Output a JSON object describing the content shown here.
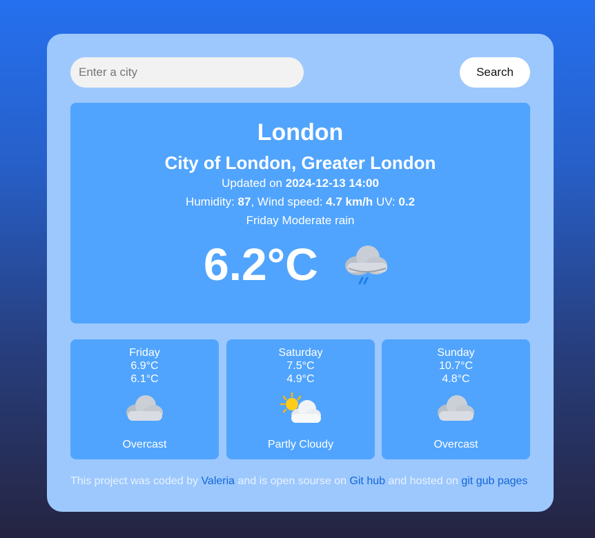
{
  "search": {
    "placeholder": "Enter a city",
    "button_label": "Search"
  },
  "current": {
    "city": "London",
    "region": "City of London, Greater London",
    "updated_label": "Updated on",
    "updated_value": "2024-12-13 14:00",
    "humidity_label": "Humidity:",
    "humidity_value": "87",
    "wind_label": "Wind speed:",
    "wind_value": "4.7 km/h",
    "uv_label": "UV:",
    "uv_value": "0.2",
    "description": "Friday Moderate rain",
    "temperature": "6.2°C",
    "icon": "rain-cloud-icon"
  },
  "forecast": [
    {
      "day": "Friday",
      "high": "6.9°C",
      "low": "6.1°C",
      "condition": "Overcast",
      "icon": "cloud-icon"
    },
    {
      "day": "Saturday",
      "high": "7.5°C",
      "low": "4.9°C",
      "condition": "Partly Cloudy",
      "icon": "sun-behind-cloud-icon"
    },
    {
      "day": "Sunday",
      "high": "10.7°C",
      "low": "4.8°C",
      "condition": "Overcast",
      "icon": "cloud-icon"
    }
  ],
  "footer": {
    "text_1": "This project was coded by",
    "author": "Valeria",
    "text_2": "and is open sourse on",
    "repo_link": "Git hub",
    "text_3": "and hosted on",
    "host_link": "git gub pages"
  },
  "colors": {
    "card": "#9dc8fd",
    "panel": "#50a4fd",
    "link": "#1166d8"
  }
}
